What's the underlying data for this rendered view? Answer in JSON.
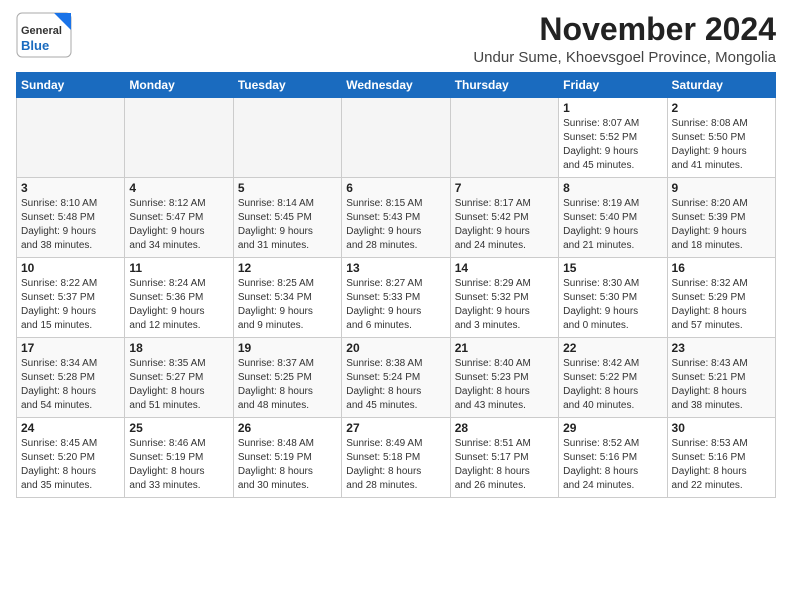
{
  "header": {
    "logo": {
      "general": "General",
      "blue": "Blue"
    },
    "title": "November 2024",
    "location": "Undur Sume, Khoevsgoel Province, Mongolia"
  },
  "calendar": {
    "weekdays": [
      "Sunday",
      "Monday",
      "Tuesday",
      "Wednesday",
      "Thursday",
      "Friday",
      "Saturday"
    ],
    "weeks": [
      [
        {
          "day": "",
          "info": ""
        },
        {
          "day": "",
          "info": ""
        },
        {
          "day": "",
          "info": ""
        },
        {
          "day": "",
          "info": ""
        },
        {
          "day": "",
          "info": ""
        },
        {
          "day": "1",
          "info": "Sunrise: 8:07 AM\nSunset: 5:52 PM\nDaylight: 9 hours\nand 45 minutes."
        },
        {
          "day": "2",
          "info": "Sunrise: 8:08 AM\nSunset: 5:50 PM\nDaylight: 9 hours\nand 41 minutes."
        }
      ],
      [
        {
          "day": "3",
          "info": "Sunrise: 8:10 AM\nSunset: 5:48 PM\nDaylight: 9 hours\nand 38 minutes."
        },
        {
          "day": "4",
          "info": "Sunrise: 8:12 AM\nSunset: 5:47 PM\nDaylight: 9 hours\nand 34 minutes."
        },
        {
          "day": "5",
          "info": "Sunrise: 8:14 AM\nSunset: 5:45 PM\nDaylight: 9 hours\nand 31 minutes."
        },
        {
          "day": "6",
          "info": "Sunrise: 8:15 AM\nSunset: 5:43 PM\nDaylight: 9 hours\nand 28 minutes."
        },
        {
          "day": "7",
          "info": "Sunrise: 8:17 AM\nSunset: 5:42 PM\nDaylight: 9 hours\nand 24 minutes."
        },
        {
          "day": "8",
          "info": "Sunrise: 8:19 AM\nSunset: 5:40 PM\nDaylight: 9 hours\nand 21 minutes."
        },
        {
          "day": "9",
          "info": "Sunrise: 8:20 AM\nSunset: 5:39 PM\nDaylight: 9 hours\nand 18 minutes."
        }
      ],
      [
        {
          "day": "10",
          "info": "Sunrise: 8:22 AM\nSunset: 5:37 PM\nDaylight: 9 hours\nand 15 minutes."
        },
        {
          "day": "11",
          "info": "Sunrise: 8:24 AM\nSunset: 5:36 PM\nDaylight: 9 hours\nand 12 minutes."
        },
        {
          "day": "12",
          "info": "Sunrise: 8:25 AM\nSunset: 5:34 PM\nDaylight: 9 hours\nand 9 minutes."
        },
        {
          "day": "13",
          "info": "Sunrise: 8:27 AM\nSunset: 5:33 PM\nDaylight: 9 hours\nand 6 minutes."
        },
        {
          "day": "14",
          "info": "Sunrise: 8:29 AM\nSunset: 5:32 PM\nDaylight: 9 hours\nand 3 minutes."
        },
        {
          "day": "15",
          "info": "Sunrise: 8:30 AM\nSunset: 5:30 PM\nDaylight: 9 hours\nand 0 minutes."
        },
        {
          "day": "16",
          "info": "Sunrise: 8:32 AM\nSunset: 5:29 PM\nDaylight: 8 hours\nand 57 minutes."
        }
      ],
      [
        {
          "day": "17",
          "info": "Sunrise: 8:34 AM\nSunset: 5:28 PM\nDaylight: 8 hours\nand 54 minutes."
        },
        {
          "day": "18",
          "info": "Sunrise: 8:35 AM\nSunset: 5:27 PM\nDaylight: 8 hours\nand 51 minutes."
        },
        {
          "day": "19",
          "info": "Sunrise: 8:37 AM\nSunset: 5:25 PM\nDaylight: 8 hours\nand 48 minutes."
        },
        {
          "day": "20",
          "info": "Sunrise: 8:38 AM\nSunset: 5:24 PM\nDaylight: 8 hours\nand 45 minutes."
        },
        {
          "day": "21",
          "info": "Sunrise: 8:40 AM\nSunset: 5:23 PM\nDaylight: 8 hours\nand 43 minutes."
        },
        {
          "day": "22",
          "info": "Sunrise: 8:42 AM\nSunset: 5:22 PM\nDaylight: 8 hours\nand 40 minutes."
        },
        {
          "day": "23",
          "info": "Sunrise: 8:43 AM\nSunset: 5:21 PM\nDaylight: 8 hours\nand 38 minutes."
        }
      ],
      [
        {
          "day": "24",
          "info": "Sunrise: 8:45 AM\nSunset: 5:20 PM\nDaylight: 8 hours\nand 35 minutes."
        },
        {
          "day": "25",
          "info": "Sunrise: 8:46 AM\nSunset: 5:19 PM\nDaylight: 8 hours\nand 33 minutes."
        },
        {
          "day": "26",
          "info": "Sunrise: 8:48 AM\nSunset: 5:19 PM\nDaylight: 8 hours\nand 30 minutes."
        },
        {
          "day": "27",
          "info": "Sunrise: 8:49 AM\nSunset: 5:18 PM\nDaylight: 8 hours\nand 28 minutes."
        },
        {
          "day": "28",
          "info": "Sunrise: 8:51 AM\nSunset: 5:17 PM\nDaylight: 8 hours\nand 26 minutes."
        },
        {
          "day": "29",
          "info": "Sunrise: 8:52 AM\nSunset: 5:16 PM\nDaylight: 8 hours\nand 24 minutes."
        },
        {
          "day": "30",
          "info": "Sunrise: 8:53 AM\nSunset: 5:16 PM\nDaylight: 8 hours\nand 22 minutes."
        }
      ]
    ]
  }
}
